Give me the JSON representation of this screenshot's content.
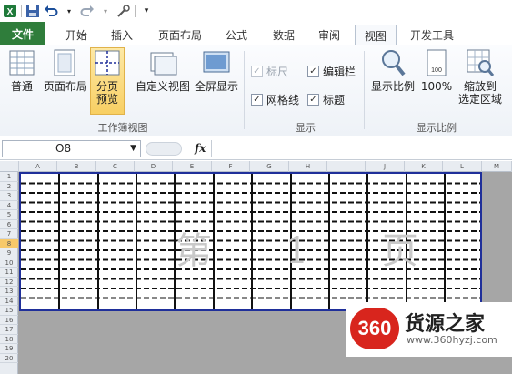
{
  "quick_access": {
    "icons": [
      "excel-logo-icon",
      "save-icon",
      "undo-icon",
      "redo-icon",
      "customize-icon"
    ]
  },
  "tabs": [
    "文件",
    "开始",
    "插入",
    "页面布局",
    "公式",
    "数据",
    "审阅",
    "视图",
    "开发工具"
  ],
  "active_tab": "视图",
  "workbook_views": {
    "buttons": [
      "普通",
      "页面布局",
      "分页\n预览",
      "自定义视图",
      "全屏显示"
    ],
    "selected": "分页\n预览",
    "group_label": "工作簿视图"
  },
  "show": {
    "ruler": "标尺",
    "formula_bar": "编辑栏",
    "gridlines": "网格线",
    "headings": "标题",
    "group_label": "显示"
  },
  "zoom": {
    "zoom_label": "显示比例",
    "hundred_label": "100%",
    "zoom_to_selection": "缩放到\n选定区域",
    "group_label": "显示比例"
  },
  "formula_bar": {
    "name_box": "O8",
    "fx": "fx",
    "content": ""
  },
  "sheet": {
    "columns": [
      "A",
      "B",
      "C",
      "D",
      "E",
      "F",
      "G",
      "H",
      "I",
      "J",
      "K",
      "L",
      "M"
    ],
    "rows": [
      "1",
      "2",
      "3",
      "4",
      "5",
      "6",
      "7",
      "8",
      "9",
      "10",
      "11",
      "12",
      "13",
      "14",
      "15",
      "16",
      "17",
      "18",
      "19",
      "20"
    ],
    "selected_row": "8",
    "watermark": "第 1 页"
  },
  "logo": {
    "badge": "360",
    "name": "货源之家",
    "url": "www.360hyzj.com"
  }
}
